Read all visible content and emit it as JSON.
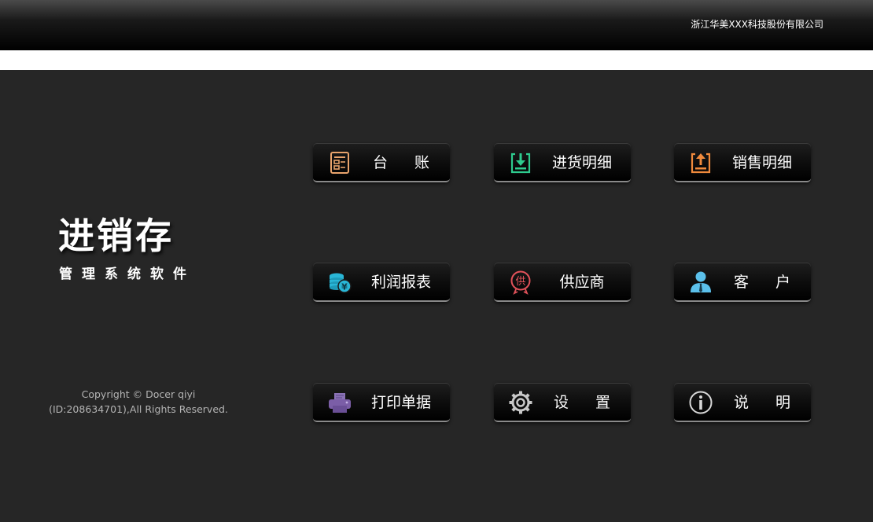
{
  "header": {
    "company": "浙江华美XXX科技股份有限公司"
  },
  "logo": {
    "title": "进销存",
    "subtitle": "管理系统软件"
  },
  "copyright": {
    "line1": "Copyright © Docer qiyi",
    "line2": "(ID:208634701),All Rights Reserved."
  },
  "menu": [
    {
      "label": "台 账",
      "icon": "ledger-icon",
      "color": "#e8a36c"
    },
    {
      "label": "进货明细",
      "icon": "download-box-icon",
      "color": "#2ecc8f"
    },
    {
      "label": "销售明细",
      "icon": "upload-box-icon",
      "color": "#f08a3c"
    },
    {
      "label": "利润报表",
      "icon": "coins-yen-icon",
      "color": "#29b6d6"
    },
    {
      "label": "供应商",
      "icon": "supplier-badge-icon",
      "color": "#e2525a"
    },
    {
      "label": "客 户",
      "icon": "customer-person-icon",
      "color": "#5bc0eb"
    },
    {
      "label": "打印单据",
      "icon": "printer-icon",
      "color": "#7b5ea7"
    },
    {
      "label": "设 置",
      "icon": "gear-icon",
      "color": "#c8c8c8"
    },
    {
      "label": "说 明",
      "icon": "info-icon",
      "color": "#d8d8d8"
    }
  ]
}
